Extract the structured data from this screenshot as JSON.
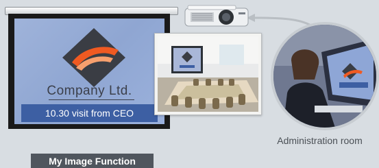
{
  "screen": {
    "company_name": "Company Ltd.",
    "visit_message": "10.30 visit from CEO"
  },
  "admin": {
    "label": "Administration room"
  },
  "function_badge": {
    "label": "My Image Function"
  },
  "colors": {
    "background": "#d8dde2",
    "screen_surface": "#9fb3da",
    "visit_bar": "#3d5fa3",
    "logo_dark": "#3a3d44",
    "logo_orange": "#f05a22",
    "badge": "#50565e"
  },
  "icons": {
    "projector": "projector-icon",
    "logo": "company-logo"
  }
}
